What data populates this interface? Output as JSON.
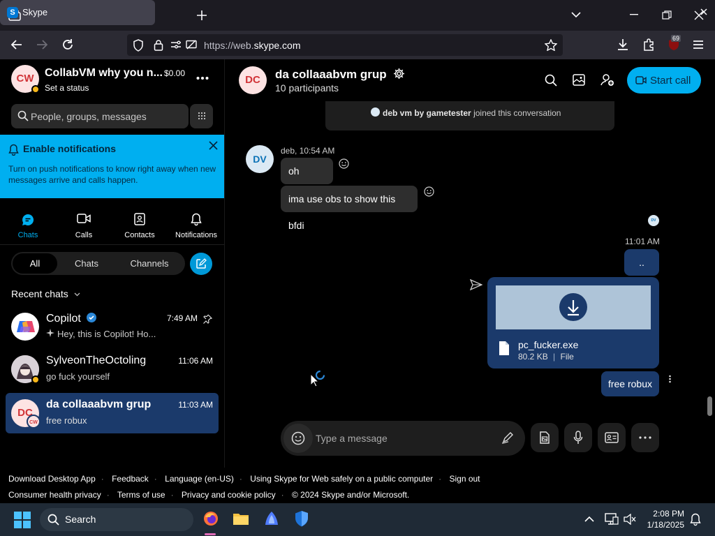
{
  "browser": {
    "tab_title": "Skype",
    "tab_favicon": "S",
    "url_prefix": "https://web.",
    "url_host": "skype.com",
    "extension_badge": "69"
  },
  "profile": {
    "initials": "CW",
    "name": "CollabVM why you n...",
    "credit": "$0.00",
    "status_label": "Set a status"
  },
  "search": {
    "placeholder": "People, groups, messages"
  },
  "notification_banner": {
    "title": "Enable notifications",
    "body": "Turn on push notifications to know right away when new messages arrive and calls happen."
  },
  "nav": {
    "chats": "Chats",
    "calls": "Calls",
    "contacts": "Contacts",
    "notifications": "Notifications"
  },
  "filters": {
    "all": "All",
    "chats": "Chats",
    "channels": "Channels"
  },
  "recent_label": "Recent chats",
  "chats": [
    {
      "name": "Copilot",
      "preview": "Hey, this is Copilot! Ho...",
      "time": "7:49 AM"
    },
    {
      "name": "SylveonTheOctoling",
      "preview": "go fuck yourself",
      "time": "11:06 AM"
    },
    {
      "name": "da collaaabvm grup",
      "preview": "free robux",
      "time": "11:03 AM",
      "initials": "DC",
      "badge": "CW"
    }
  ],
  "conversation": {
    "initials": "DC",
    "title": "da collaaabvm grup",
    "participants": "10 participants",
    "start_call": "Start call",
    "system_message": {
      "actor": "deb vm by gametester",
      "text": "joined this conversation"
    },
    "incoming": {
      "initials": "DV",
      "sender_time": "deb, 10:54 AM",
      "messages": [
        "oh",
        "ima use obs to show this bfdi"
      ]
    },
    "outgoing": {
      "seen_initials": "DV",
      "time": "11:01 AM",
      "message_1": "..",
      "file": {
        "name": "pc_fucker.exe",
        "size": "80.2 KB",
        "type": "File"
      },
      "message_2": "free robux"
    },
    "composer_placeholder": "Type a message"
  },
  "footer": {
    "row1": [
      "Download Desktop App",
      "Feedback",
      "Language (en-US)",
      "Using Skype for Web safely on a public computer",
      "Sign out"
    ],
    "row2": [
      "Consumer health privacy",
      "Terms of use",
      "Privacy and cookie policy",
      "© 2024 Skype and/or Microsoft."
    ]
  },
  "taskbar": {
    "search_label": "Search",
    "time": "2:08 PM",
    "date": "1/18/2025"
  },
  "colors": {
    "accent": "#00aff0",
    "selected_chat": "#1b3a6b",
    "bubble_in": "#2e2e2e",
    "avatar_bg": "#fde3e3",
    "avatar_text": "#d13438"
  }
}
